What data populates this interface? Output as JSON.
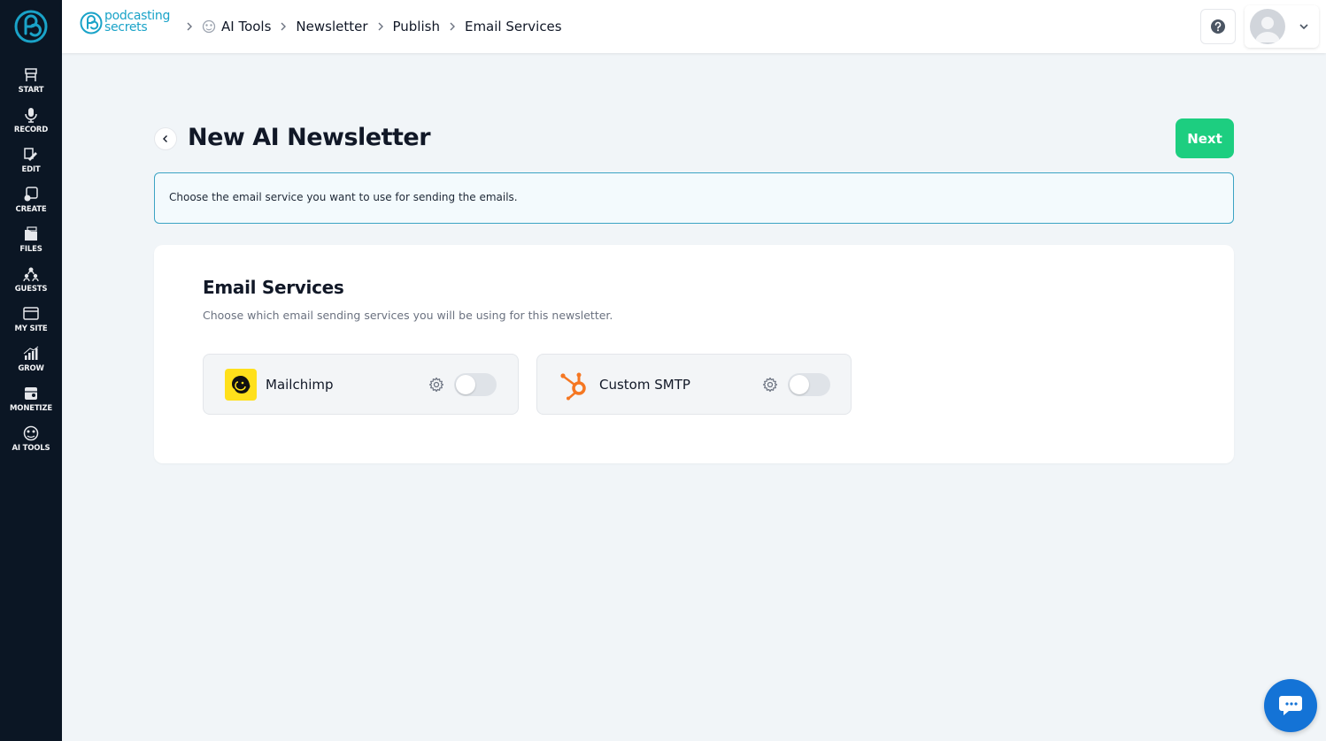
{
  "sidebar": {
    "items": [
      {
        "label": "START",
        "icon": "start-icon"
      },
      {
        "label": "RECORD",
        "icon": "microphone-icon"
      },
      {
        "label": "EDIT",
        "icon": "edit-icon"
      },
      {
        "label": "CREATE",
        "icon": "create-icon"
      },
      {
        "label": "FILES",
        "icon": "files-icon"
      },
      {
        "label": "GUESTS",
        "icon": "guests-icon"
      },
      {
        "label": "MY SITE",
        "icon": "site-icon"
      },
      {
        "label": "GROW",
        "icon": "grow-icon"
      },
      {
        "label": "MONETIZE",
        "icon": "monetize-icon"
      },
      {
        "label": "AI TOOLS",
        "icon": "ai-tools-icon"
      }
    ]
  },
  "header": {
    "brand_line1": "podcasting",
    "brand_line2": "secrets",
    "breadcrumbs": [
      "AI Tools",
      "Newsletter",
      "Publish",
      "Email Services"
    ]
  },
  "main": {
    "title": "New AI Newsletter",
    "next_label": "Next",
    "info_text": "Choose the email service you want to use for sending the emails."
  },
  "email_services": {
    "title": "Email Services",
    "subtitle": "Choose which email sending services you will be using for this newsletter.",
    "services": [
      {
        "name": "Mailchimp",
        "enabled": false,
        "icon": "mailchimp-icon",
        "color": "#ffe01b"
      },
      {
        "name": "Custom SMTP",
        "enabled": false,
        "icon": "hubspot-icon",
        "color": "#f57722"
      }
    ]
  },
  "colors": {
    "sidebar": "#0b1624",
    "accent_green": "#1dce80",
    "accent_teal": "#1aa3c8",
    "chat_blue": "#1473d6"
  }
}
